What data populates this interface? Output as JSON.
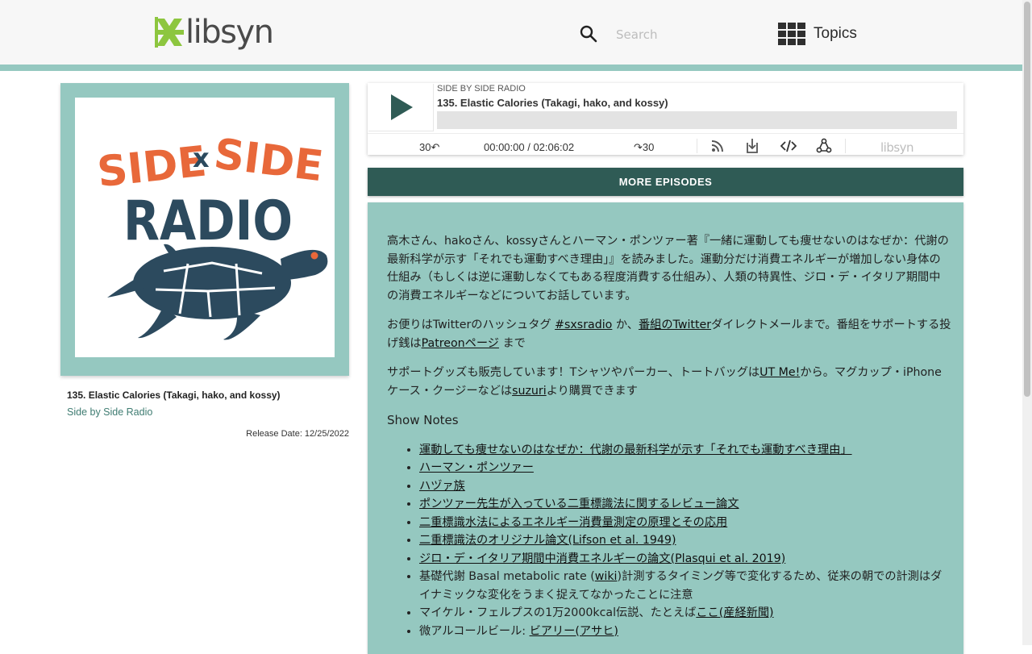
{
  "header": {
    "logo_text": "libsyn",
    "search_placeholder": "Search",
    "topics_label": "Topics",
    "colors": {
      "accent_bar": "#95c8c0",
      "logo_green": "#8dc63f"
    }
  },
  "artwork": {
    "line1_left": "SIDE",
    "line1_x": "x",
    "line1_right": "SIDE",
    "line2": "RADIO",
    "colors": {
      "orange": "#e8683a",
      "navy": "#2c4a5e"
    }
  },
  "episode": {
    "title": "135. Elastic Calories (Takagi, hako, and kossy)",
    "show_name": "Side by Side Radio",
    "release_date": "Release Date: 12/25/2022"
  },
  "player": {
    "show_label": "SIDE BY SIDE RADIO",
    "title": "135. Elastic Calories (Takagi, hako, and kossy)",
    "rewind_label": "30↶",
    "time_display": "00:00:00 / 02:06:02",
    "forward_label": "↷30",
    "brand": "libsyn",
    "progress": 0
  },
  "more_episodes_label": "MORE EPISODES",
  "description": {
    "p1": "高木さん、hakoさん、kossyさんとハーマン・ポンツァー著『一緒に運動しても痩せないのはなぜか：代謝の最新科学が示す「それでも運動すべき理由」』を読みました。運動分だけ消費エネルギーが増加しない身体の仕組み（もしくは逆に運動しなくてもある程度消費する仕組み）、人類の特異性、ジロ・デ・イタリア期間中の消費エネルギーなどについてお話しています。",
    "p2_a": "お便りはTwitterのハッシュタグ ",
    "p2_link1": "#sxsradio",
    "p2_b": " か、",
    "p2_link2": "番組のTwitter",
    "p2_c": "ダイレクトメールまで。番組をサポートする投げ銭は",
    "p2_link3": "Patreonページ",
    "p2_d": " まで",
    "p3_a": "サポートグッズも販売しています！Tシャツやパーカー、トートバッグは",
    "p3_link1": "UT Me!",
    "p3_b": "から。マグカップ・iPhoneケース・クージーなどは",
    "p3_link2": "suzuri",
    "p3_c": "より購買できます",
    "notes_title": "Show Notes",
    "notes": {
      "n1": "運動しても痩せないのはなぜか：代謝の最新科学が示す「それでも運動すべき理由」",
      "n2": "ハーマン・ポンツァー",
      "n3": "ハヅァ族",
      "n4": "ポンツァー先生が入っている二重標識法に関するレビュー論文",
      "n5": "二重標識水法によるエネルギー消費量測定の原理とその応用",
      "n6": "二重標識法のオリジナル論文(Lifson et al. 1949)",
      "n7": "ジロ・デ・イタリア期間中消費エネルギーの論文(Plasqui et al. 2019)",
      "n8_a": "基礎代謝 Basal metabolic rate (",
      "n8_link": "wiki",
      "n8_b": ")計測するタイミング等で変化するため、従来の朝での計測はダイナミックな変化をうまく捉えてなかったことに注意",
      "n9_a": "マイケル・フェルプスの1万2000kcal伝説、たとえば",
      "n9_link": "ここ(産経新聞)",
      "n10_a": "微アルコールビール: ",
      "n10_link": "ビアリー(アサヒ)"
    }
  }
}
